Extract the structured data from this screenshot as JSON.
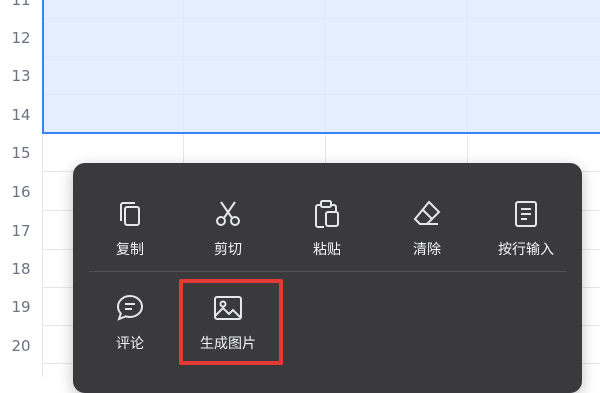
{
  "rows": [
    "11",
    "12",
    "13",
    "14",
    "15",
    "16",
    "17",
    "18",
    "19",
    "20"
  ],
  "menu": {
    "items": [
      {
        "label": "复制",
        "icon": "copy-icon"
      },
      {
        "label": "剪切",
        "icon": "cut-icon"
      },
      {
        "label": "粘贴",
        "icon": "paste-icon"
      },
      {
        "label": "清除",
        "icon": "eraser-icon"
      },
      {
        "label": "按行输入",
        "icon": "document-icon"
      },
      {
        "label": "评论",
        "icon": "comment-icon"
      },
      {
        "label": "生成图片",
        "icon": "image-icon"
      }
    ]
  },
  "colors": {
    "selection_border": "#3b82f6",
    "selection_fill": "#dbeafe",
    "menu_background": "#3a3a3c",
    "highlight_box": "#e53935"
  }
}
